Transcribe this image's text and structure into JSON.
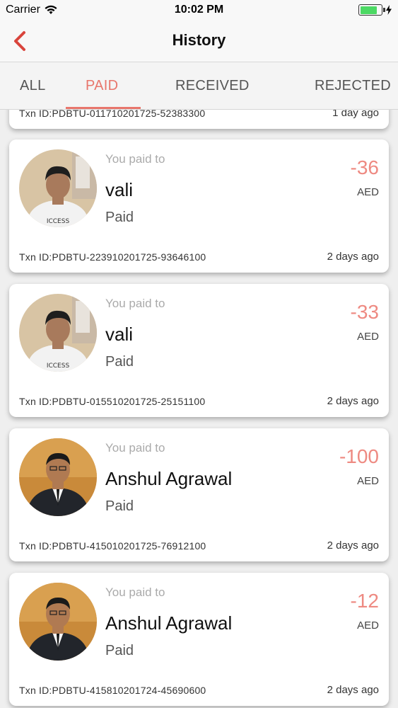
{
  "status_bar": {
    "carrier": "Carrier",
    "time": "10:02 PM",
    "battery_level": 0.8
  },
  "nav": {
    "title": "History"
  },
  "tabs": [
    {
      "label": "ALL",
      "active": false
    },
    {
      "label": "PAID",
      "active": true
    },
    {
      "label": "RECEIVED",
      "active": false
    },
    {
      "label": "REJECTED",
      "active": false
    }
  ],
  "partial_card": {
    "txn": "Txn ID:PDBTU-011710201725-52383300",
    "time": "1 day ago"
  },
  "transactions": [
    {
      "label": "You paid to",
      "name": "vali",
      "status": "Paid",
      "amount": "-36",
      "currency": "AED",
      "txn": "Txn ID:PDBTU-223910201725-93646100",
      "time": "2 days ago",
      "avatar": "avatar-vali"
    },
    {
      "label": "You paid to",
      "name": "vali",
      "status": "Paid",
      "amount": "-33",
      "currency": "AED",
      "txn": "Txn ID:PDBTU-015510201725-25151100",
      "time": "2 days ago",
      "avatar": "avatar-vali"
    },
    {
      "label": "You paid to",
      "name": "Anshul Agrawal",
      "status": "Paid",
      "amount": "-100",
      "currency": "AED",
      "txn": "Txn ID:PDBTU-415010201725-76912100",
      "time": "2 days ago",
      "avatar": "avatar-anshul"
    },
    {
      "label": "You paid to",
      "name": "Anshul Agrawal",
      "status": "Paid",
      "amount": "-12",
      "currency": "AED",
      "txn": "Txn ID:PDBTU-415810201724-45690600",
      "time": "2 days ago",
      "avatar": "avatar-anshul"
    }
  ],
  "colors": {
    "accent": "#e8766c",
    "amount": "#ee8a82",
    "back": "#d9443c"
  }
}
